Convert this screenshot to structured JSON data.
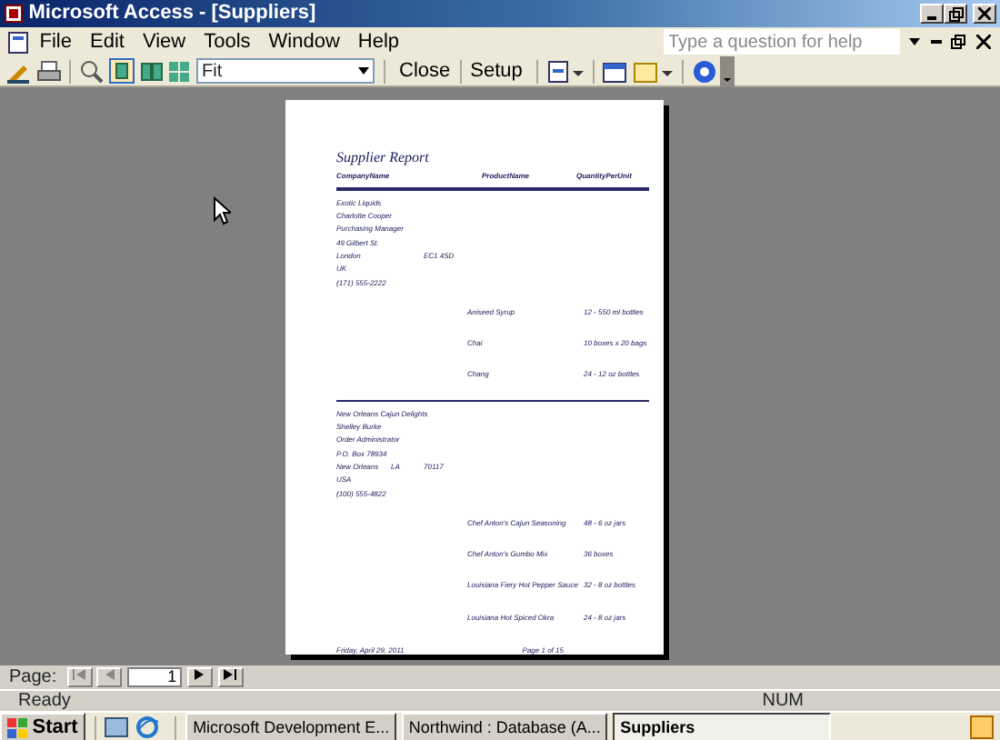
{
  "window": {
    "title": "Microsoft Access - [Suppliers]"
  },
  "menu": [
    "File",
    "Edit",
    "View",
    "Tools",
    "Window",
    "Help"
  ],
  "help_box": {
    "placeholder": "Type a question for help"
  },
  "toolbar": {
    "zoom": "Fit",
    "buttons": [
      "Close",
      "Setup"
    ]
  },
  "report": {
    "title": "Supplier Report",
    "columns": [
      "CompanyName",
      "ProductName",
      "QuantityPerUnit"
    ],
    "suppliers": [
      {
        "company": "Exotic Liquids",
        "contact": "Charlotte Cooper",
        "contact_title": "Purchasing Manager",
        "address": "49 Gilbert St.",
        "city": "London",
        "postal": "EC1 4SD",
        "country": "UK",
        "phone": "(171) 555-2222",
        "products": [
          {
            "name": "Aniseed Syrup",
            "qty": "12 - 550 ml bottles"
          },
          {
            "name": "Chai",
            "qty": "10 boxes x 20 bags"
          },
          {
            "name": "Chang",
            "qty": "24 - 12 oz bottles"
          }
        ]
      },
      {
        "company": "New Orleans Cajun Delights",
        "contact": "Shelley Burke",
        "contact_title": "Order Administrator",
        "address": "P.O. Box 78934",
        "city": "New Orleans",
        "region": "LA",
        "postal": "70117",
        "country": "USA",
        "phone": "(100) 555-4822",
        "products": [
          {
            "name": "Chef Anton's Cajun Seasoning",
            "qty": "48 - 6 oz jars"
          },
          {
            "name": "Chef Anton's Gumbo Mix",
            "qty": "36 boxes"
          },
          {
            "name": "Louisiana Fiery Hot Pepper Sauce",
            "qty": "32 - 8 oz bottles"
          },
          {
            "name": "Louisiana Hot Spiced Okra",
            "qty": "24 - 8 oz jars"
          }
        ]
      }
    ],
    "footer_date": "Friday, April 29, 2011",
    "footer_page": "Page 1 of 15"
  },
  "navigation": {
    "label": "Page:",
    "page": "1"
  },
  "status_bar": {
    "text": "Ready",
    "indicator": "NUM"
  },
  "taskbar": {
    "start": "Start",
    "tasks": [
      {
        "label": "Microsoft Development E...",
        "selected": false
      },
      {
        "label": "Northwind : Database (A...",
        "selected": false
      },
      {
        "label": "Suppliers",
        "selected": true
      }
    ]
  }
}
